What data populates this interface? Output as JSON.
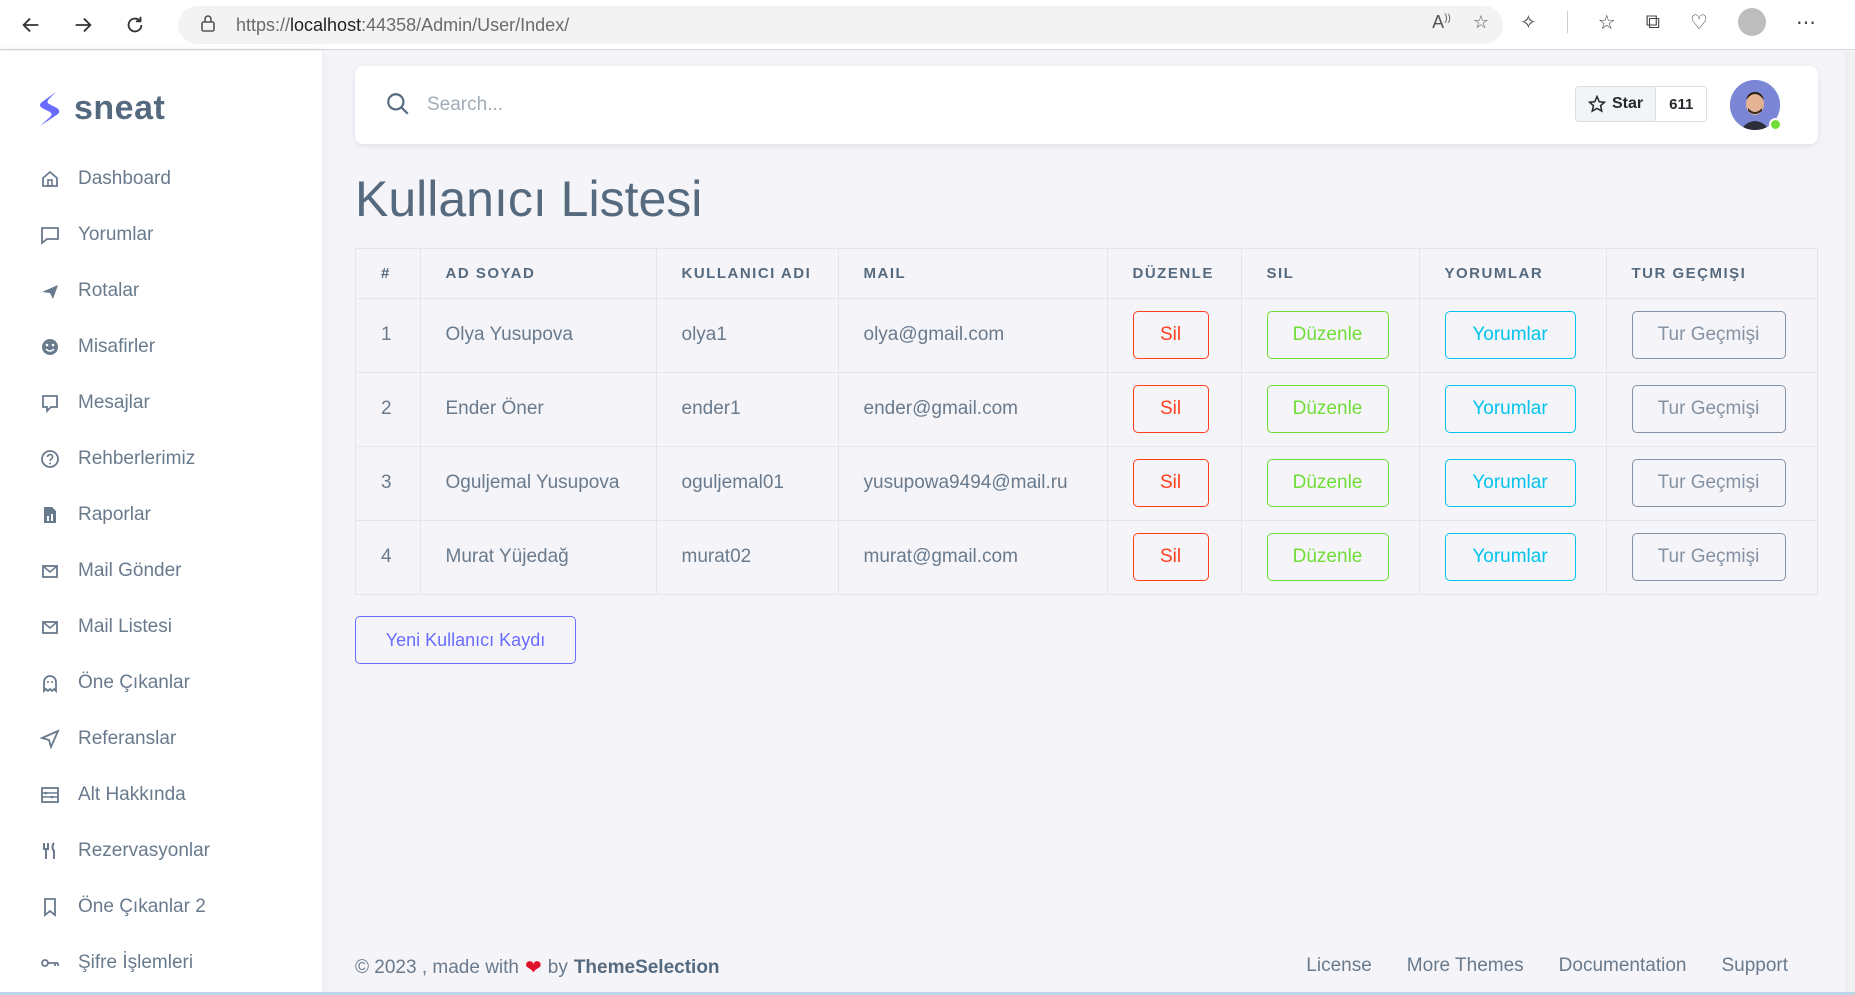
{
  "browser": {
    "url_prefix": "https://",
    "url_host": "localhost",
    "url_rest": ":44358/Admin/User/Index/"
  },
  "brand": {
    "name": "sneat",
    "color": "#696cff"
  },
  "sidebar": {
    "items": [
      {
        "label": "Dashboard",
        "icon": "home-icon"
      },
      {
        "label": "Yorumlar",
        "icon": "comment-icon"
      },
      {
        "label": "Rotalar",
        "icon": "plane-icon"
      },
      {
        "label": "Misafirler",
        "icon": "smile-icon"
      },
      {
        "label": "Mesajlar",
        "icon": "message-icon"
      },
      {
        "label": "Rehberlerimiz",
        "icon": "help-circle-icon"
      },
      {
        "label": "Raporlar",
        "icon": "report-icon"
      },
      {
        "label": "Mail Gönder",
        "icon": "mail-send-icon"
      },
      {
        "label": "Mail Listesi",
        "icon": "mail-list-icon"
      },
      {
        "label": "Öne Çıkanlar",
        "icon": "ghost-icon"
      },
      {
        "label": "Referanslar",
        "icon": "send-icon"
      },
      {
        "label": "Alt Hakkında",
        "icon": "abacus-icon"
      },
      {
        "label": "Rezervasyonlar",
        "icon": "restaurant-icon"
      },
      {
        "label": "Öne Çıkanlar 2",
        "icon": "bookmark-icon"
      },
      {
        "label": "Şifre İşlemleri",
        "icon": "key-icon"
      }
    ]
  },
  "navbar": {
    "search_placeholder": "Search...",
    "star_label": "Star",
    "star_count": "611"
  },
  "page": {
    "title": "Kullanıcı Listesi",
    "new_button": "Yeni Kullanıcı Kaydı"
  },
  "table": {
    "headers": [
      "#",
      "AD SOYAD",
      "KULLANICI ADI",
      "MAIL",
      "DÜZENLE",
      "SIL",
      "YORUMLAR",
      "TUR GEÇMIŞI"
    ],
    "action_labels": {
      "sil": "Sil",
      "duzenle": "Düzenle",
      "yorumlar": "Yorumlar",
      "tur": "Tur Geçmişi"
    },
    "rows": [
      {
        "no": "1",
        "name": "Olya Yusupova",
        "username": "olya1",
        "mail": "olya@gmail.com"
      },
      {
        "no": "2",
        "name": "Ender Öner",
        "username": "ender1",
        "mail": "ender@gmail.com"
      },
      {
        "no": "3",
        "name": "Oguljemal Yusupova",
        "username": "oguljemal01",
        "mail": "yusupowa9494@mail.ru"
      },
      {
        "no": "4",
        "name": "Murat Yüjedağ",
        "username": "murat02",
        "mail": "murat@gmail.com"
      }
    ]
  },
  "footer": {
    "prefix": "© 2023 , made with",
    "by": "by",
    "brand": "ThemeSelection",
    "links": [
      "License",
      "More Themes",
      "Documentation",
      "Support"
    ]
  }
}
